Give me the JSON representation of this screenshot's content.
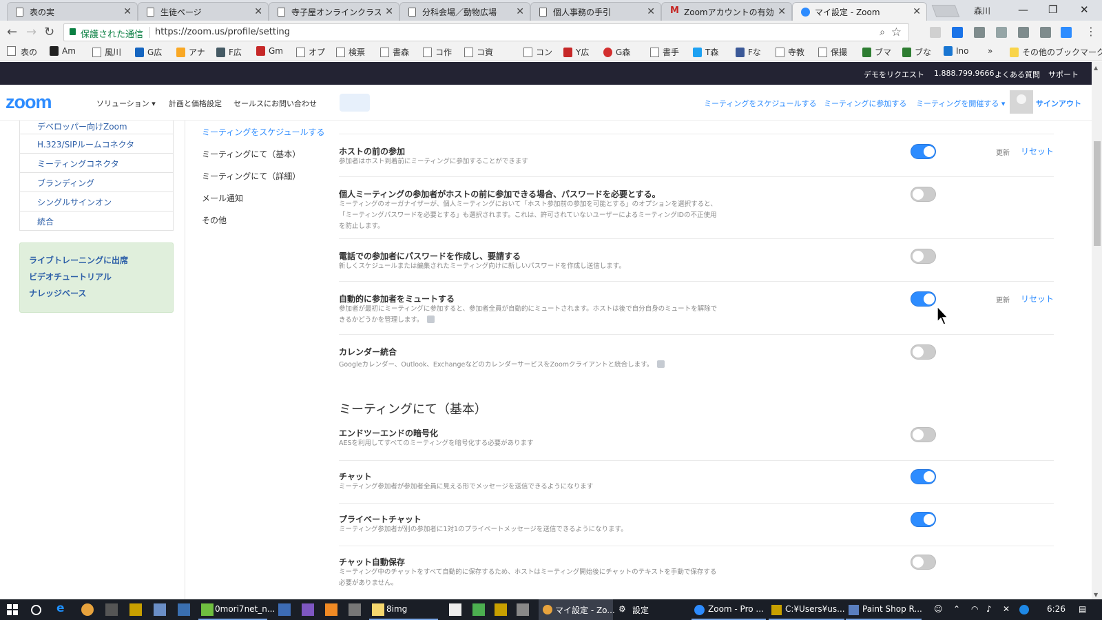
{
  "browser": {
    "tabs": [
      {
        "label": "表の実",
        "icon": "page"
      },
      {
        "label": "生徒ページ",
        "icon": "page"
      },
      {
        "label": "寺子屋オンラインクラス一覧",
        "icon": "page"
      },
      {
        "label": "分科会場／動物広場",
        "icon": "page"
      },
      {
        "label": "個人事務の手引",
        "icon": "page"
      },
      {
        "label": "Zoomアカウントの有効化 -",
        "icon": "gmail"
      },
      {
        "label": "マイ設定 - Zoom",
        "icon": "zoom"
      }
    ],
    "profile_name": "森川",
    "secure_label": "保護された通信",
    "url": "https://zoom.us/profile/setting",
    "bookmarks": [
      "表の",
      "Am",
      "風川",
      "G広",
      "アナ",
      "F広",
      "Gm",
      "オプ",
      "検票",
      "書森",
      "コ作",
      "コ資",
      "コン",
      "Y広",
      "G森",
      "書手",
      "T森",
      "Fな",
      "寺教",
      "保撮",
      "ブマ",
      "ブな",
      "Ino"
    ],
    "bookmarks_more": "»",
    "other_bookmarks": "その他のブックマーク"
  },
  "topbar": {
    "demo": "デモをリクエスト",
    "phone": "1.888.799.9666",
    "faq": "よくある質問",
    "support": "サポート"
  },
  "header": {
    "logo": "zoom",
    "nav": [
      "ソリューション ▾",
      "計画と価格設定",
      "セールスにお問い合わせ"
    ],
    "right": [
      "ミーティングをスケジュールする",
      "ミーティングに参加する",
      "ミーティングを開催する ▾"
    ],
    "signout": "サインアウト"
  },
  "sidebar": {
    "items": [
      "デベロッパー向けZoom",
      "H.323/SIPルームコネクタ",
      "ミーティングコネクタ",
      "ブランディング",
      "シングルサインオン",
      "統合"
    ],
    "box": [
      "ライブトレーニングに出席",
      "ビデオチュートリアル",
      "ナレッジベース"
    ]
  },
  "subnav": [
    {
      "label": "ミーティングをスケジュールする",
      "active": true
    },
    {
      "label": "ミーティングにて（基本）",
      "active": false
    },
    {
      "label": "ミーティングにて（詳細）",
      "active": false
    },
    {
      "label": "メール通知",
      "active": false
    },
    {
      "label": "その他",
      "active": false
    }
  ],
  "settings": [
    {
      "title": "ホストの前の参加",
      "desc": "参加者はホスト到着前にミーティングに参加することができます",
      "on": true,
      "update": "更新",
      "reset": "リセット"
    },
    {
      "title": "個人ミーティングの参加者がホストの前に参加できる場合、パスワードを必要とする。",
      "desc": "ミーティングのオーガナイザーが、個人ミーティングにおいて「ホスト参加前の参加を可能とする」のオプションを選択すると、「ミーティングパスワードを必要とする」も選択されます。これは、許可されていないユーザーによるミーティングIDの不正使用を防止します。",
      "on": false
    },
    {
      "title": "電話での参加者にパスワードを作成し、要請する",
      "desc": "新しくスケジュールまたは編集されたミーティング向けに新しいパスワードを作成し送信します。",
      "on": false
    },
    {
      "title": "自動的に参加者をミュートする",
      "desc": "参加者が最初にミーティングに参加すると、参加者全員が自動的にミュートされます。ホストは後で自分自身のミュートを解除できるかどうかを管理します。",
      "on": true,
      "update": "更新",
      "reset": "リセット"
    },
    {
      "title": "カレンダー統合",
      "desc": "Googleカレンダー、Outlook、ExchangeなどのカレンダーサービスをZoomクライアントと統合します。",
      "on": false
    }
  ],
  "section2": {
    "title": "ミーティングにて（基本）",
    "settings": [
      {
        "title": "エンドツーエンドの暗号化",
        "desc": "AESを利用してすべてのミーティングを暗号化する必要があります",
        "on": false
      },
      {
        "title": "チャット",
        "desc": "ミーティング参加者が参加者全員に見える形でメッセージを送信できるようになります",
        "on": true
      },
      {
        "title": "プライベートチャット",
        "desc": "ミーティング参加者が別の参加者に1対1のプライベートメッセージを送信できるようになります。",
        "on": true
      },
      {
        "title": "チャット自動保存",
        "desc": "ミーティング中のチャットをすべて自動的に保存するため、ホストはミーティング開始後にチャットのテキストを手動で保存する必要がありません。",
        "on": false
      }
    ]
  },
  "taskbar": {
    "apps": [
      "0mori7net_n...",
      "8img",
      "マイ設定 - Zo...",
      "設定",
      "Zoom - Pro ...",
      "C:¥Users¥us...",
      "Paint Shop R..."
    ],
    "time": "6:26"
  }
}
